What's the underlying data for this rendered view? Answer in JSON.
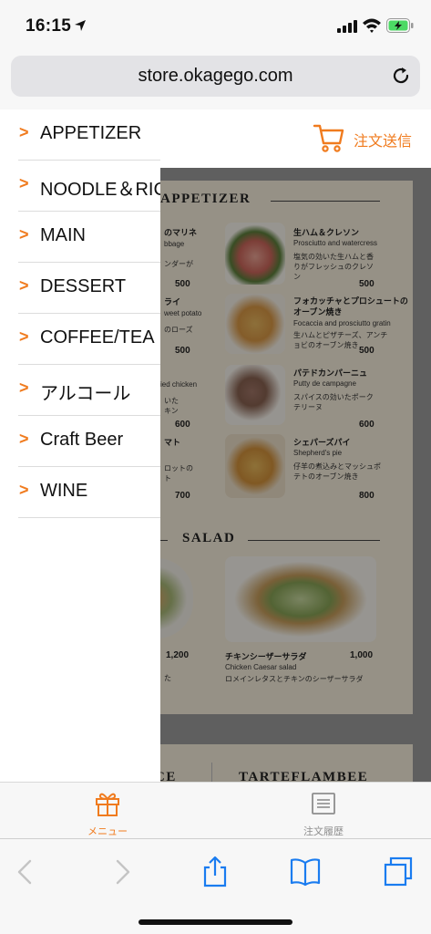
{
  "status_bar": {
    "time": "16:15"
  },
  "browser": {
    "url": "store.okagego.com"
  },
  "header": {
    "submit_order": "注文送信"
  },
  "drawer": {
    "items": [
      {
        "label": "APPETIZER"
      },
      {
        "label": "NOODLE＆RICE"
      },
      {
        "label": "MAIN"
      },
      {
        "label": "DESSERT"
      },
      {
        "label": "COFFEE/TEA"
      },
      {
        "label": "アルコール"
      },
      {
        "label": "Craft Beer"
      },
      {
        "label": "WINE"
      }
    ],
    "chevron": ">"
  },
  "menu_image": {
    "section_appetizer": "APPETIZER",
    "section_salad": "SALAD",
    "section_lower_left": "CE",
    "section_lower_right": "TARTEFLAMBEE",
    "dishes": [
      {
        "jp": "生ハム＆クレソン",
        "en": "Prosciutto and watercress",
        "desc": "塩気の効いた生ハムと香りがフレッシュのクレソン",
        "price": "500"
      },
      {
        "jp": "フォカッチャとプロシュートのオーブン焼き",
        "en": "Focaccia and prosciutto gratin",
        "desc": "生ハムとピザチーズ、アンチョビのオーブン焼き",
        "price": "500"
      },
      {
        "jp": "パテドカンパーニュ",
        "en": "Putty de campagne",
        "desc": "スパイスの効いたポークテリーヌ",
        "price": "600"
      },
      {
        "jp": "シェパーズパイ",
        "en": "Shepherd's pie",
        "desc": "仔羊の煮込みとマッシュポテトのオーブン焼き",
        "price": "800"
      },
      {
        "jp": "チキンシーザーサラダ",
        "en": "Chicken Caesar salad",
        "desc": "ロメインレタスとチキンのシーザーサラダ",
        "price": "1,000"
      }
    ],
    "left_fragments": [
      {
        "text": "のマリネ",
        "sub": "bbage",
        "sub2": "ンダーが",
        "price": "500"
      },
      {
        "text": "ライ",
        "sub": "weet potato",
        "sub2": "のローズ",
        "price": "500"
      },
      {
        "text": "",
        "sub": "ied chicken",
        "sub2": "いた\nキン",
        "price": "600"
      },
      {
        "text": "マト",
        "sub": "",
        "sub2": "ロットの\nト",
        "price": "700"
      },
      {
        "text": "",
        "sub": "",
        "sub2": "た",
        "price": "1,200"
      }
    ]
  },
  "tabs": [
    {
      "label": "メニュー",
      "active": true,
      "icon": "gift-icon"
    },
    {
      "label": "注文履歴",
      "active": false,
      "icon": "order-history-icon"
    }
  ],
  "colors": {
    "accent": "#f07b1e",
    "ios_blue": "#1a7cf0",
    "inactive": "#8e8e8e"
  }
}
